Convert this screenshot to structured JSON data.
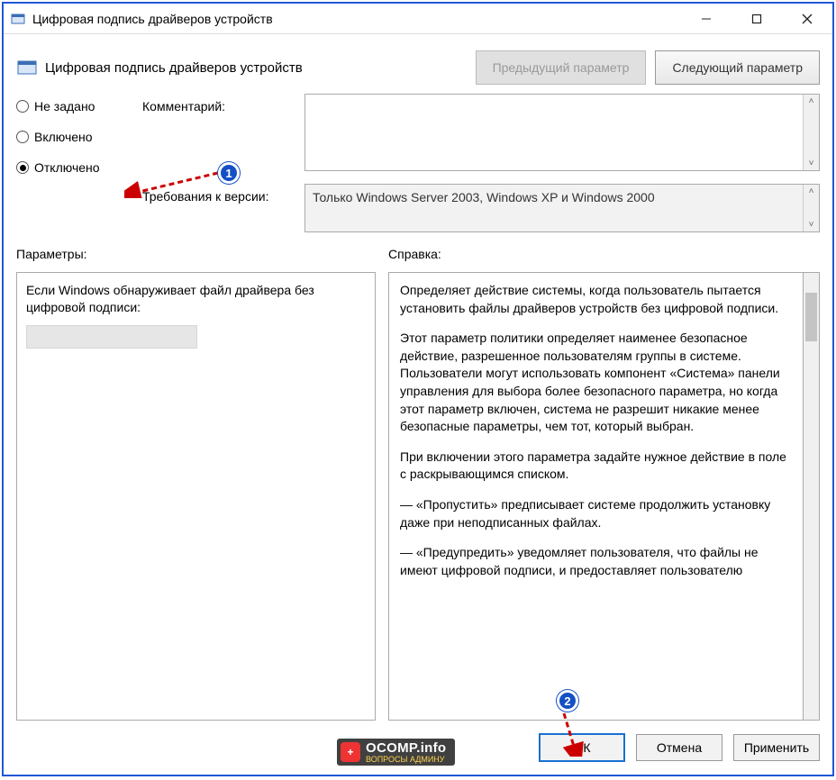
{
  "titlebar": {
    "title": "Цифровая подпись драйверов устройств"
  },
  "header": {
    "title": "Цифровая подпись драйверов устройств",
    "prev_btn": "Предыдущий параметр",
    "next_btn": "Следующий параметр"
  },
  "radios": {
    "not_configured": "Не задано",
    "enabled": "Включено",
    "disabled": "Отключено",
    "selected": "disabled"
  },
  "fields": {
    "comment_label": "Комментарий:",
    "requirements_label": "Требования к версии:",
    "requirements_value": "Только Windows Server 2003, Windows XP и Windows 2000"
  },
  "section_labels": {
    "params": "Параметры:",
    "help": "Справка:"
  },
  "params": {
    "text": "Если Windows обнаруживает файл драйвера без цифровой подписи:"
  },
  "help": {
    "p1": "Определяет действие системы, когда пользователь пытается установить файлы драйверов устройств без цифровой подписи.",
    "p2": "Этот параметр политики определяет наименее безопасное действие, разрешенное пользователям группы в системе. Пользователи могут использовать компонент «Система» панели управления для выбора более безопасного параметра, но когда этот параметр включен, система не разрешит никакие менее безопасные параметры, чем тот, который выбран.",
    "p3": "При включении этого параметра задайте нужное действие в поле с раскрывающимся списком.",
    "p4": "— «Пропустить» предписывает системе продолжить установку даже при неподписанных файлах.",
    "p5": "— «Предупредить» уведомляет пользователя, что файлы не имеют цифровой подписи, и предоставляет пользователю"
  },
  "footer": {
    "ok": "ОК",
    "cancel": "Отмена",
    "apply": "Применить"
  },
  "watermark": {
    "main": "OCOMP.info",
    "sub": "ВОПРОСЫ АДМИНУ"
  },
  "annotations": {
    "badge1": "1",
    "badge2": "2"
  }
}
